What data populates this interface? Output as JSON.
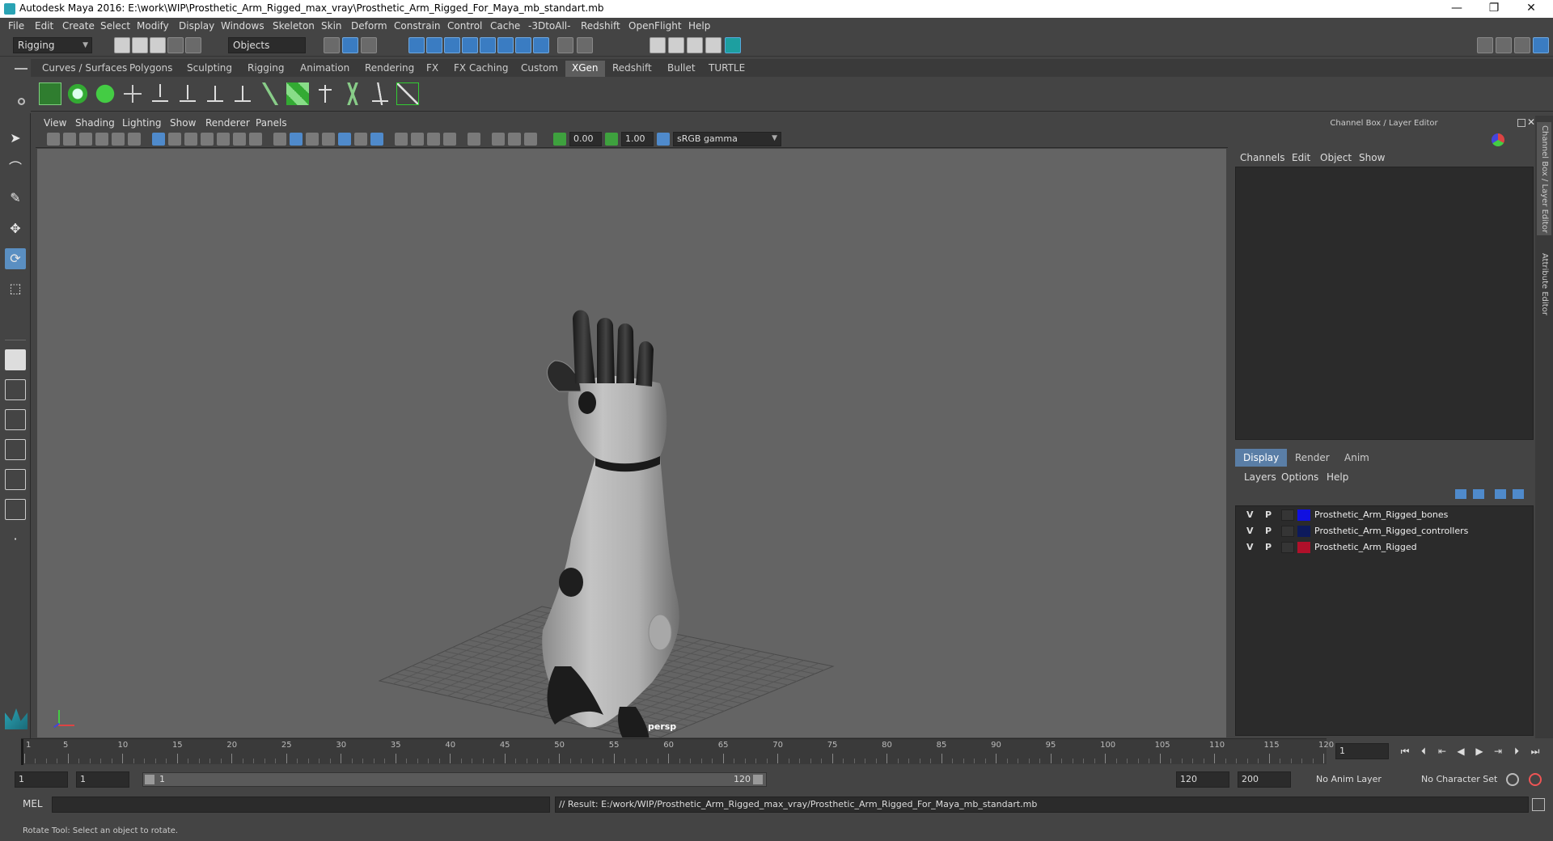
{
  "titlebar": {
    "title": "Autodesk Maya 2016: E:\\work\\WIP\\Prosthetic_Arm_Rigged_max_vray\\Prosthetic_Arm_Rigged_For_Maya_mb_standart.mb",
    "minimize": "—",
    "restore": "❐",
    "close": "✕"
  },
  "menubar": {
    "items": [
      "File",
      "Edit",
      "Create",
      "Select",
      "Modify",
      "Display",
      "Windows",
      "Skeleton",
      "Skin",
      "Deform",
      "Constrain",
      "Control",
      "Cache",
      "-3DtoAll-",
      "Redshift",
      "OpenFlight",
      "Help"
    ]
  },
  "statusline": {
    "menuset": "Rigging",
    "selection_mode": "Objects"
  },
  "shelf": {
    "tabs": [
      "Curves / Surfaces",
      "Polygons",
      "Sculpting",
      "Rigging",
      "Animation",
      "Rendering",
      "FX",
      "FX Caching",
      "Custom",
      "XGen",
      "Redshift",
      "Bullet",
      "TURTLE"
    ],
    "active_tab": "XGen"
  },
  "viewport": {
    "menu": [
      "View",
      "Shading",
      "Lighting",
      "Show",
      "Renderer",
      "Panels"
    ],
    "exposure": "0.00",
    "gamma": "1.00",
    "color_space": "sRGB gamma",
    "camera_label": "persp"
  },
  "channelbox": {
    "title": "Channel Box / Layer Editor",
    "menu": [
      "Channels",
      "Edit",
      "Object",
      "Show"
    ],
    "layer_tabs": [
      "Display",
      "Render",
      "Anim"
    ],
    "active_layer_tab": "Display",
    "layer_menu": [
      "Layers",
      "Options",
      "Help"
    ],
    "layers": [
      {
        "v": "V",
        "p": "P",
        "name": "Prosthetic_Arm_Rigged_bones",
        "color": "#1010e0"
      },
      {
        "v": "V",
        "p": "P",
        "name": "Prosthetic_Arm_Rigged_controllers",
        "color": "#0d1a5c"
      },
      {
        "v": "V",
        "p": "P",
        "name": "Prosthetic_Arm_Rigged",
        "color": "#b0102a"
      }
    ]
  },
  "sidetabs": {
    "channel_box": "Channel Box / Layer Editor",
    "attribute_editor": "Attribute Editor"
  },
  "timeslider": {
    "ticks": [
      "1",
      "5",
      "10",
      "15",
      "20",
      "25",
      "30",
      "35",
      "40",
      "45",
      "50",
      "55",
      "60",
      "65",
      "70",
      "75",
      "80",
      "85",
      "90",
      "95",
      "100",
      "105",
      "110",
      "115",
      "120"
    ],
    "current_frame": "1"
  },
  "rangebar": {
    "start": "1",
    "playback_start": "1",
    "range_start_label": "1",
    "range_end_label": "120",
    "playback_end": "120",
    "end": "200",
    "anim_layer": "No Anim Layer",
    "character_set": "No Character Set"
  },
  "cmdline": {
    "lang": "MEL",
    "result": "// Result: E:/work/WIP/Prosthetic_Arm_Rigged_max_vray/Prosthetic_Arm_Rigged_For_Maya_mb_standart.mb"
  },
  "helpline": {
    "text": "Rotate Tool: Select an object to rotate."
  }
}
